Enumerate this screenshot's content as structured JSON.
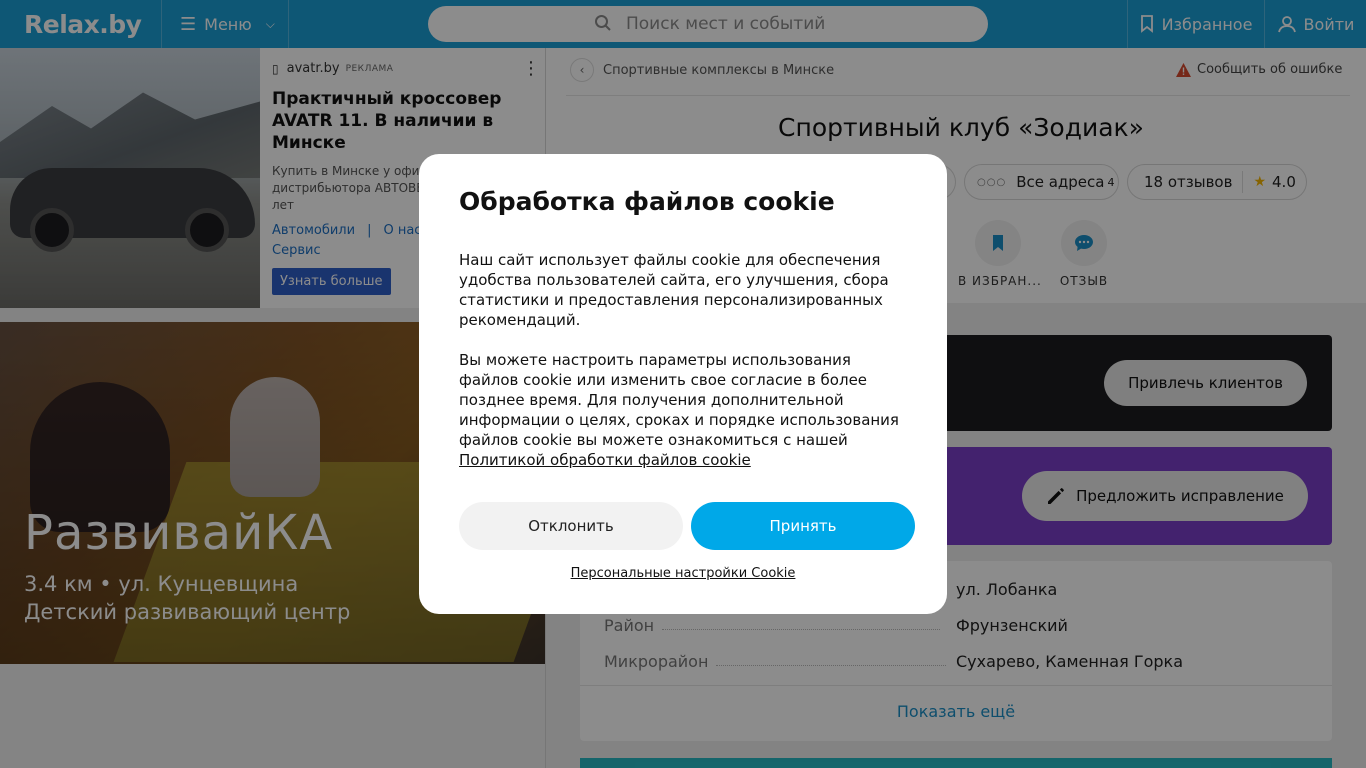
{
  "header": {
    "logo": "Relax.by",
    "menu_label": "Меню",
    "search_placeholder": "Поиск мест и событий",
    "favorites_label": "Избранное",
    "login_label": "Войти"
  },
  "ad": {
    "source": "avatr.by",
    "tag": "РЕКЛАМА",
    "title": "Практичный кроссовер AVATR 11. В наличии в Минске",
    "description_line1": "Купить в Минске у офиц",
    "description_line2": "дистрибьютора АВТОВЕ",
    "description_line3": "лет",
    "links": [
      "Автомобили",
      "О нас",
      "Сервис"
    ],
    "cta": "Узнать больше"
  },
  "promo": {
    "title": "РазвивайКА",
    "address": "3.4 км • ул. Кунцевщина",
    "category": "Детский развивающий центр"
  },
  "breadcrumb": {
    "label": "Спортивные комплексы в Минске",
    "report": "Сообщить об ошибке"
  },
  "place": {
    "title": "Спортивный клуб «Зодиак»",
    "all_addresses": "Все адреса",
    "addresses_count": "4",
    "reviews": "18 отзывов",
    "rating": "4.0",
    "actions": {
      "favorite": "В ИЗБРАН...",
      "review": "ОТЗЫВ"
    }
  },
  "banners": {
    "attract": "Привлечь клиентов",
    "suggest": "Предложить исправление"
  },
  "info": {
    "rows": [
      {
        "key": "",
        "value": "ул. Лобанка"
      },
      {
        "key": "Район",
        "value": "Фрунзенский"
      },
      {
        "key": "Микрорайон",
        "value": "Сухарево, Каменная Горка"
      }
    ],
    "show_more": "Показать ещё"
  },
  "cookie_modal": {
    "title": "Обработка файлов cookie",
    "paragraph1": "Наш сайт использует файлы cookie для обеспечения удобства пользователей сайта, его улучшения, сбора статистики и предоставления персонализированных рекомендаций.",
    "paragraph2": "Вы можете настроить параметры использования файлов cookie или изменить свое согласие в более позднее время. Для получения дополнительной информации о целях, сроках и порядке использования файлов cookie вы можете ознакомиться с нашей",
    "policy_link": "Политикой обработки файлов cookie",
    "decline": "Отклонить",
    "accept": "Принять",
    "personal_settings": "Персональные настройки Cookie"
  },
  "colors": {
    "header": "#1b9fd6",
    "accept_button": "#00a8e8",
    "purple_banner": "#7a3ec8",
    "dark_banner": "#1d1d1f",
    "link": "#1b8fc7"
  }
}
